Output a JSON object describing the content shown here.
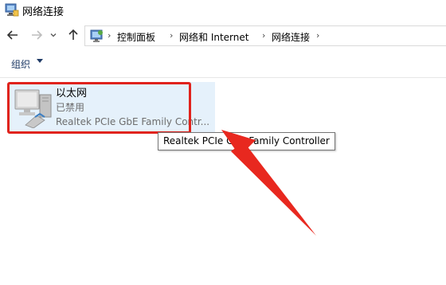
{
  "window": {
    "title": "网络连接",
    "title_icon": "network-connections-icon"
  },
  "nav": {
    "back_icon": "back-arrow-icon",
    "forward_icon": "forward-arrow-icon",
    "recent_icon": "chevron-down-icon",
    "up_icon": "up-arrow-icon"
  },
  "address": {
    "icon": "control-panel-icon",
    "breadcrumbs": [
      "控制面板",
      "网络和 Internet",
      "网络连接"
    ],
    "separator": "›"
  },
  "toolbar": {
    "organize_label": "组织"
  },
  "connection": {
    "name": "以太网",
    "status": "已禁用",
    "device_truncated": "Realtek PCIe GbE Family Contr...",
    "icon": "ethernet-adapter-icon"
  },
  "tooltip": {
    "text": "Realtek PCIe GbE Family Controller"
  },
  "colors": {
    "selection_bg": "#e5f1fb",
    "annotation_red": "#e0231c",
    "toolbar_text": "#1e3a66"
  }
}
